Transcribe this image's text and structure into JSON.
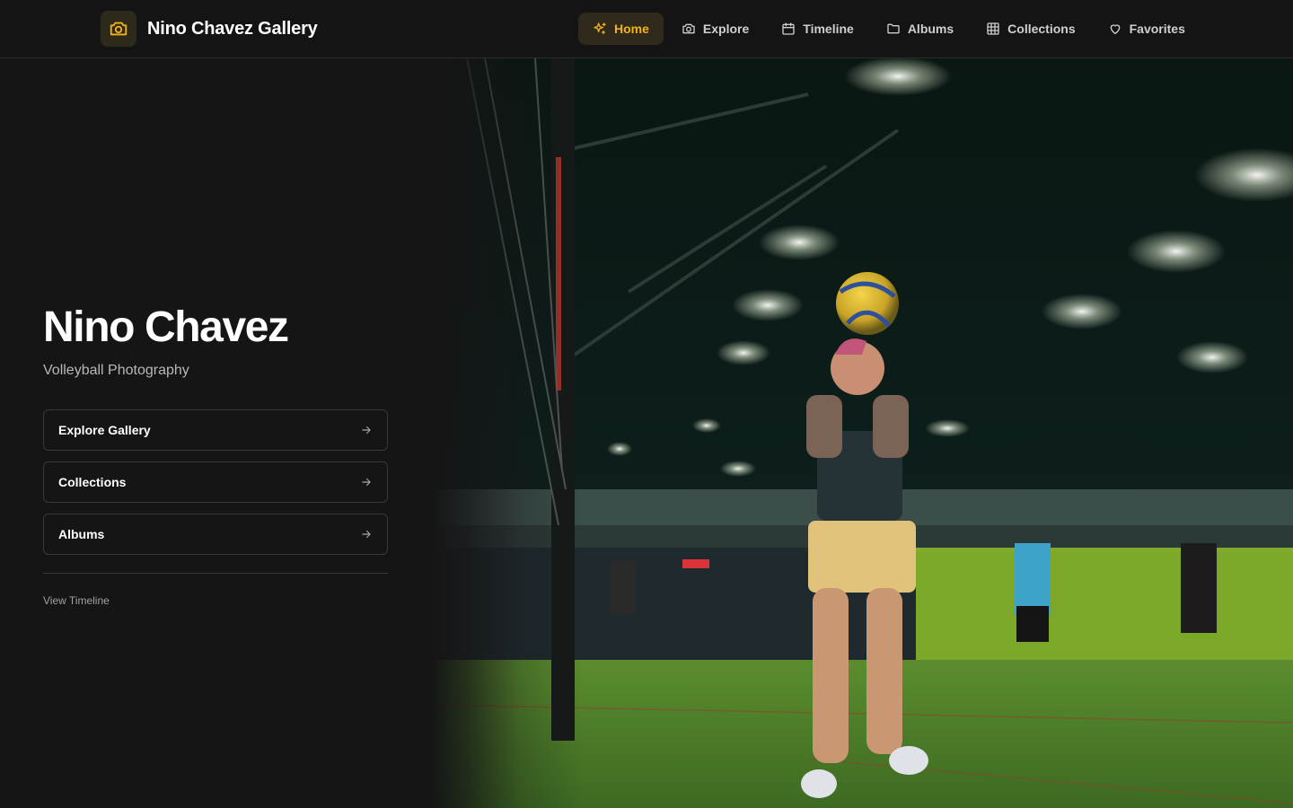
{
  "brand": {
    "title": "Nino Chavez Gallery",
    "accent": "#f2b318"
  },
  "nav": {
    "items": [
      {
        "label": "Home",
        "icon": "sparkles-icon",
        "active": true
      },
      {
        "label": "Explore",
        "icon": "camera-icon",
        "active": false
      },
      {
        "label": "Timeline",
        "icon": "calendar-icon",
        "active": false
      },
      {
        "label": "Albums",
        "icon": "folder-icon",
        "active": false
      },
      {
        "label": "Collections",
        "icon": "grid-icon",
        "active": false
      },
      {
        "label": "Favorites",
        "icon": "heart-icon",
        "active": false
      }
    ]
  },
  "hero": {
    "title": "Nino Chavez",
    "subtitle": "Volleyball Photography",
    "ctas": [
      {
        "label": "Explore Gallery",
        "icon": "arrow-right-icon"
      },
      {
        "label": "Collections",
        "icon": "arrow-right-icon"
      },
      {
        "label": "Albums",
        "icon": "arrow-right-icon"
      }
    ],
    "timeline_link": "View Timeline"
  },
  "colors": {
    "background": "#151516",
    "active_nav_bg": "#2f2a1b",
    "border": "#3a3a3d",
    "court_green": "#4f8a2a"
  }
}
